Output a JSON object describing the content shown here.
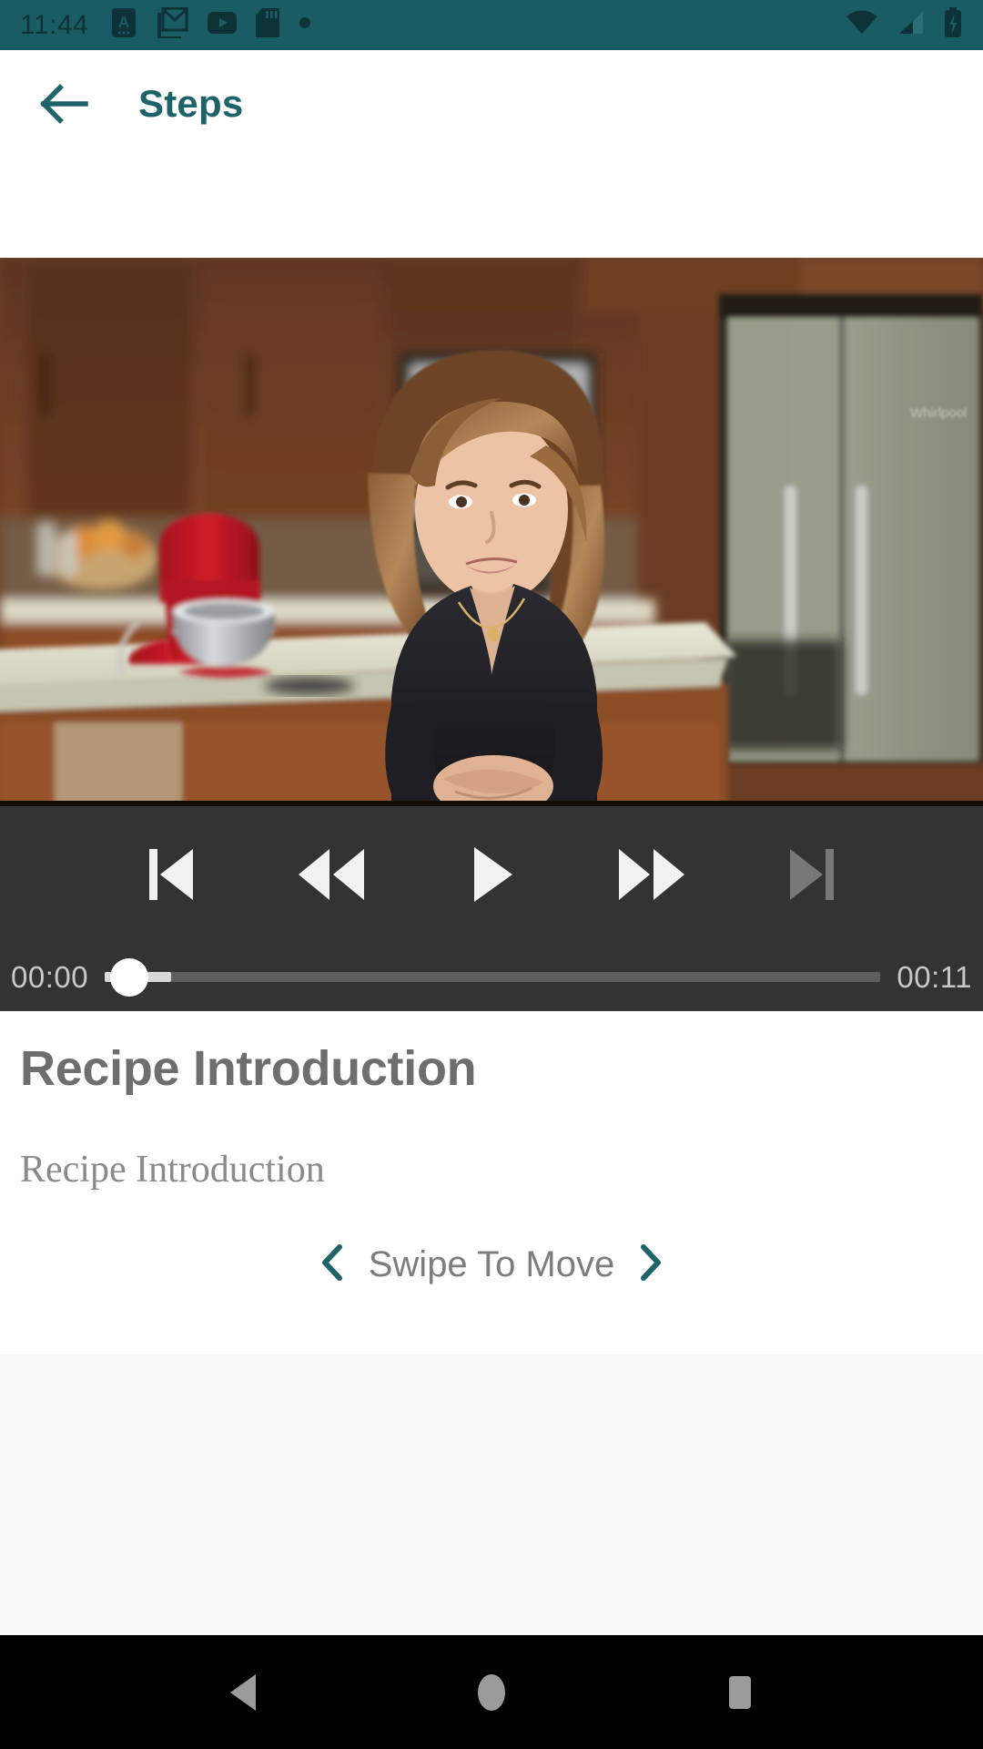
{
  "status_bar": {
    "time": "11:44",
    "background_color": "#1A5C63",
    "icon_color": "#0D3338",
    "left_icons": [
      {
        "name": "app-a-icon",
        "label": "A"
      },
      {
        "name": "gmail-icon",
        "label": "M"
      },
      {
        "name": "youtube-icon",
        "label": "▶"
      },
      {
        "name": "sd-card-icon",
        "label": "SD"
      },
      {
        "name": "notification-dot-icon",
        "label": "•"
      }
    ],
    "right_icons": [
      {
        "name": "wifi-icon",
        "label": "wifi"
      },
      {
        "name": "cellular-signal-icon",
        "label": "signal"
      },
      {
        "name": "battery-charging-icon",
        "label": "battery"
      }
    ]
  },
  "app_bar": {
    "back_label": "Back",
    "title": "Steps",
    "title_color": "#1E6368"
  },
  "video": {
    "alt": "Woman in black top standing in a kitchen with red stand mixer and stainless refrigerator",
    "scene": "kitchen"
  },
  "player": {
    "buttons": [
      {
        "name": "skip-previous-button",
        "label": "Skip Previous",
        "enabled": true
      },
      {
        "name": "rewind-button",
        "label": "Rewind",
        "enabled": true
      },
      {
        "name": "play-button",
        "label": "Play",
        "enabled": true
      },
      {
        "name": "fast-forward-button",
        "label": "Fast Forward",
        "enabled": true
      },
      {
        "name": "skip-next-button",
        "label": "Skip Next",
        "enabled": false
      }
    ],
    "current_time": "00:00",
    "total_time": "00:11",
    "progress_percent": 0,
    "buffer_percent": 8.5,
    "controls_background": "#333333"
  },
  "step": {
    "title": "Recipe Introduction",
    "description": "Recipe Introduction"
  },
  "swipe_hint": {
    "prev_label": "Previous",
    "text": "Swipe To Move",
    "next_label": "Next",
    "chevron_color": "#1E6368"
  },
  "nav_bar": {
    "buttons": [
      {
        "name": "android-back-button",
        "label": "Back"
      },
      {
        "name": "android-home-button",
        "label": "Home"
      },
      {
        "name": "android-recents-button",
        "label": "Recents"
      }
    ]
  }
}
